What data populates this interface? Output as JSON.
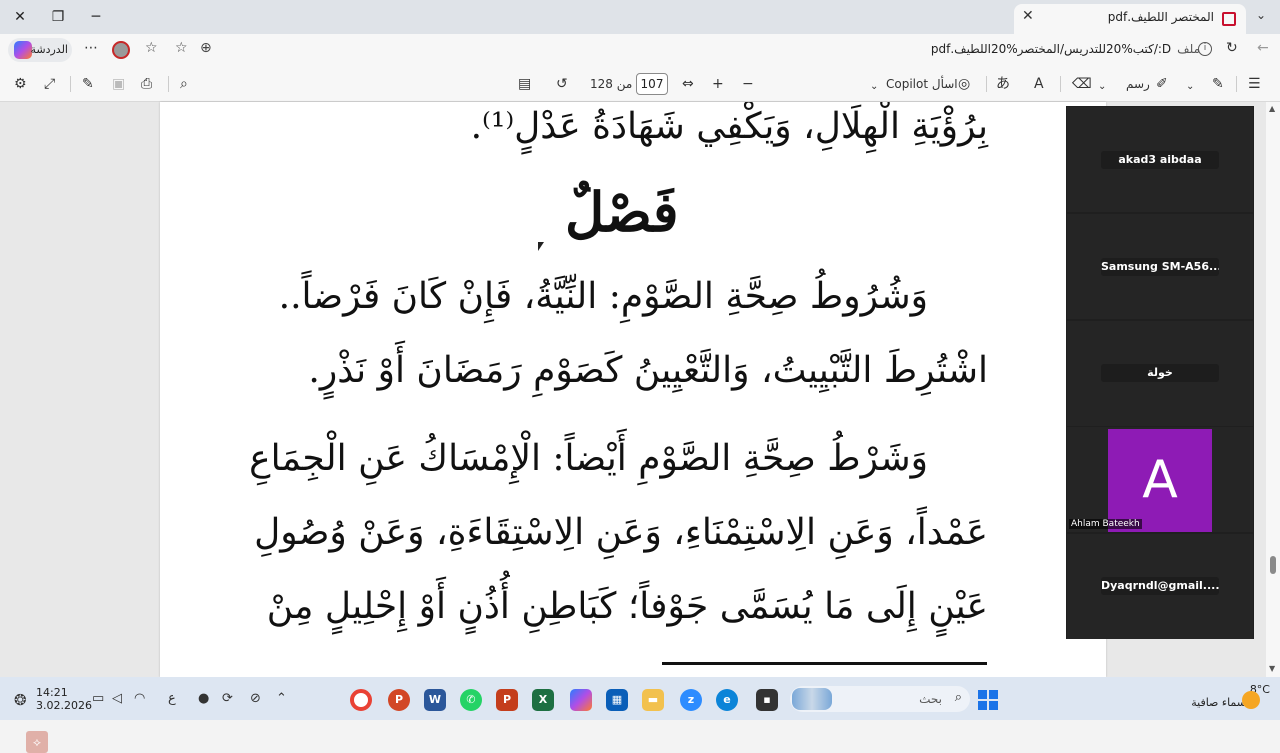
{
  "browser": {
    "tab_title": "المختصر اللطيف.pdf",
    "address_file_label": "ملف",
    "address_url": "D:/كتب%20للتدريس/المختصر%20اللطيف.pdf",
    "chat_label": "الدردشة"
  },
  "pdf_toolbar": {
    "current_page": "107",
    "page_total": "من 128",
    "ask_copilot": "اسأل Copilot",
    "draw_label": "رسم"
  },
  "document": {
    "line1": "بِرُؤْيَةِ الْهِلَالِ، وَيَكْفِي شَهَادَةُ عَدْلٍ⁽¹⁾.",
    "heading": "فَصْلٌ",
    "line2": "وَشُرُوطُ صِحَّةِ الصَّوْمِ: النِّيَّةُ، فَإِنْ كَانَ فَرْضاً..",
    "line3": "اشْتُرِطَ التَّبْيِيتُ، وَالتَّعْيِينُ كَصَوْمِ رَمَضَانَ أَوْ نَذْرٍ.",
    "line4": "وَشَرْطُ صِحَّةِ الصَّوْمِ أَيْضاً: الْإِمْسَاكُ عَنِ الْجِمَاعِ",
    "line5": "عَمْداً، وَعَنِ الِاسْتِمْنَاءِ، وَعَنِ الِاسْتِقَاءَةِ، وَعَنْ وُصُولِ",
    "line6": "عَيْنٍ إِلَى مَا يُسَمَّى جَوْفاً؛ كَبَاطِنِ أُذُنٍ أَوْ إِحْلِيلٍ مِنْ"
  },
  "video_panel": {
    "participants": [
      {
        "name": "akad3 aibdaa"
      },
      {
        "name": "Samsung  SM-A56..."
      },
      {
        "name": "خولة"
      },
      {
        "name": "Ahlam Bateekh",
        "initial": "A"
      },
      {
        "name": "Dyaqrndl@gmail...."
      }
    ]
  },
  "taskbar": {
    "search_placeholder": "بحث",
    "temperature": "8°C",
    "weather_desc": "سماء صافية",
    "time": "14:21",
    "date": "3.02.2026",
    "lang": "ع"
  }
}
